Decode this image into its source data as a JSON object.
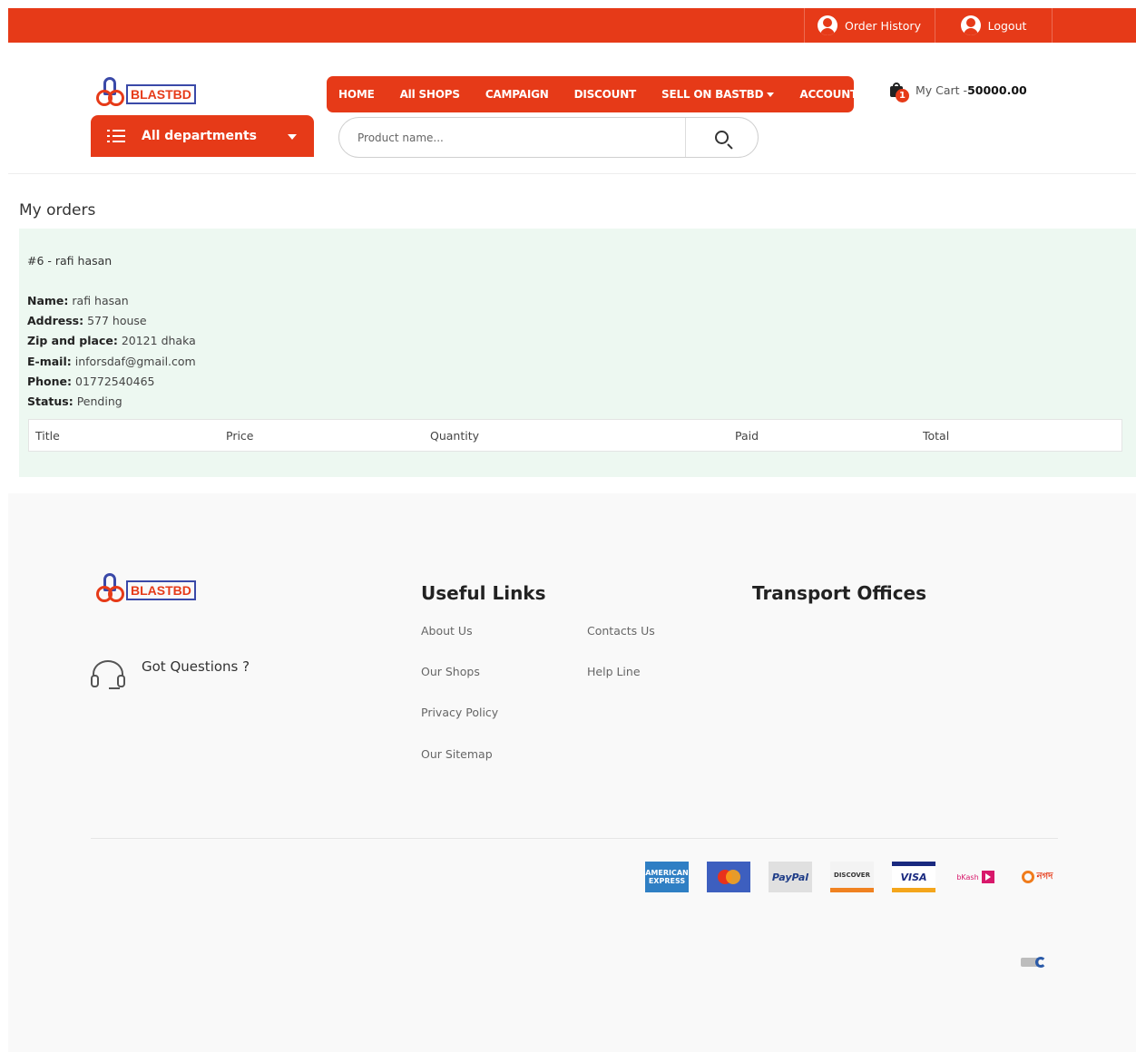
{
  "topbar": {
    "order_history": "Order History",
    "logout": "Logout"
  },
  "brand": {
    "logo_text": "BLASTBD",
    "accent_color": "#e63a18",
    "secondary_color": "#3a49a8"
  },
  "departments": {
    "label": "All departments"
  },
  "nav": {
    "items": [
      {
        "label": "HOME"
      },
      {
        "label": "All SHOPS"
      },
      {
        "label": "CAMPAIGN"
      },
      {
        "label": "DISCOUNT"
      },
      {
        "label": "SELL ON BASTBD",
        "dropdown": true
      },
      {
        "label": "ACCOUNTS",
        "dropdown": true
      }
    ]
  },
  "search": {
    "placeholder": "Product name...",
    "value": ""
  },
  "cart": {
    "count": "1",
    "label": "My Cart -",
    "amount": "50000.00"
  },
  "orders": {
    "title": "My orders",
    "order": {
      "heading": "#6 - rafi hasan",
      "fields": [
        {
          "label": "Name:",
          "value": "rafi hasan"
        },
        {
          "label": "Address:",
          "value": "577 house"
        },
        {
          "label": "Zip and place:",
          "value": "20121 dhaka"
        },
        {
          "label": "E-mail:",
          "value": "inforsdaf@gmail.com"
        },
        {
          "label": "Phone:",
          "value": "01772540465"
        },
        {
          "label": "Status:",
          "value": "Pending"
        }
      ],
      "table_headers": [
        "Title",
        "Price",
        "Quantity",
        "Paid",
        "Total"
      ]
    }
  },
  "footer": {
    "logo_text": "BLASTBD",
    "got_questions": "Got Questions ?",
    "useful_links_title": "Useful Links",
    "useful_links": [
      "About Us",
      "Contacts Us",
      "Our Shops",
      "Help Line",
      "Privacy Policy",
      "Our Sitemap"
    ],
    "transport_title": "Transport Offices",
    "payment_methods": {
      "amex": "AMERICAN EXPRESS",
      "paypal": "PayPal",
      "discover": "DISCOVER",
      "visa": "VISA",
      "bkash": "bKash",
      "nagad": "নগদ"
    }
  }
}
